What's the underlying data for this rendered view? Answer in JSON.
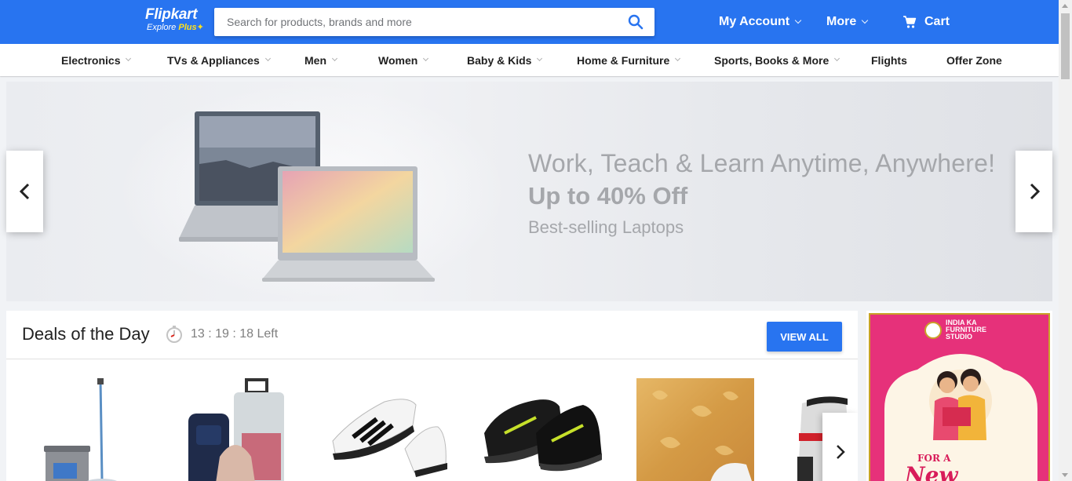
{
  "header": {
    "logo_text": "Flipkart",
    "logo_tagline_prefix": "Explore ",
    "logo_tagline_plus": "Plus",
    "search_placeholder": "Search for products, brands and more",
    "my_account_label": "My Account",
    "more_label": "More",
    "cart_label": "Cart",
    "colors": {
      "primary": "#2874f0",
      "accent": "#ffe11b"
    }
  },
  "categories": [
    {
      "label": "Electronics",
      "has_dropdown": true
    },
    {
      "label": "TVs & Appliances",
      "has_dropdown": true
    },
    {
      "label": "Men",
      "has_dropdown": true
    },
    {
      "label": "Women",
      "has_dropdown": true
    },
    {
      "label": "Baby & Kids",
      "has_dropdown": true
    },
    {
      "label": "Home & Furniture",
      "has_dropdown": true
    },
    {
      "label": "Sports, Books & More",
      "has_dropdown": true
    },
    {
      "label": "Flights",
      "has_dropdown": false
    },
    {
      "label": "Offer Zone",
      "has_dropdown": false
    }
  ],
  "banner": {
    "headline": "Work, Teach & Learn Anytime,  Anywhere!",
    "offer": "Up to 40% Off",
    "subtext": "Best-selling Laptops",
    "prev_icon": "chevron-left-icon",
    "next_icon": "chevron-right-icon"
  },
  "deals": {
    "title": "Deals of the Day",
    "timer_text": "13 : 19 : 18 Left",
    "view_all_label": "VIEW ALL",
    "products": [
      {
        "name": "spin-mop"
      },
      {
        "name": "luggage-bags"
      },
      {
        "name": "white-sneakers"
      },
      {
        "name": "fila-sports-shoes"
      },
      {
        "name": "golden-wallpaper"
      },
      {
        "name": "electric-kettle"
      }
    ]
  },
  "side_ad": {
    "brand_line1": "INDIA KA",
    "brand_line2": "FURNITURE",
    "brand_line3": "STUDIO",
    "promo_line1": "FOR A",
    "promo_line2": "New"
  }
}
